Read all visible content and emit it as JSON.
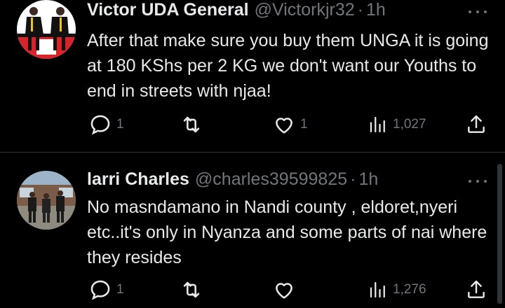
{
  "tweets": [
    {
      "name": "Victor UDA General",
      "handle": "@Victorkjr32",
      "separator": "·",
      "time": "1h",
      "text": "After that make sure you buy them UNGA it is going at 180 KShs per 2 KG we don't want our Youths to end in streets with njaa!",
      "replies": "1",
      "retweets": "",
      "likes": "1",
      "views": "1,027"
    },
    {
      "name": "larri Charles",
      "handle": "@charles39599825",
      "separator": "·",
      "time": "1h",
      "text": "No masndamano in Nandi county , eldoret,nyeri etc..it's only in Nyanza and some parts of nai where they resides",
      "replies": "1",
      "retweets": "",
      "likes": "",
      "views": "1,276"
    }
  ],
  "icons": {
    "reply": "reply-icon",
    "retweet": "retweet-icon",
    "like": "heart-icon",
    "views": "views-icon",
    "share": "share-icon",
    "more": "more-icon"
  },
  "colors": {
    "background": "#000000",
    "text": "#e7e9ea",
    "secondary": "#71767b",
    "divider": "#2f3336",
    "avatar1_red": "#d8232a"
  }
}
